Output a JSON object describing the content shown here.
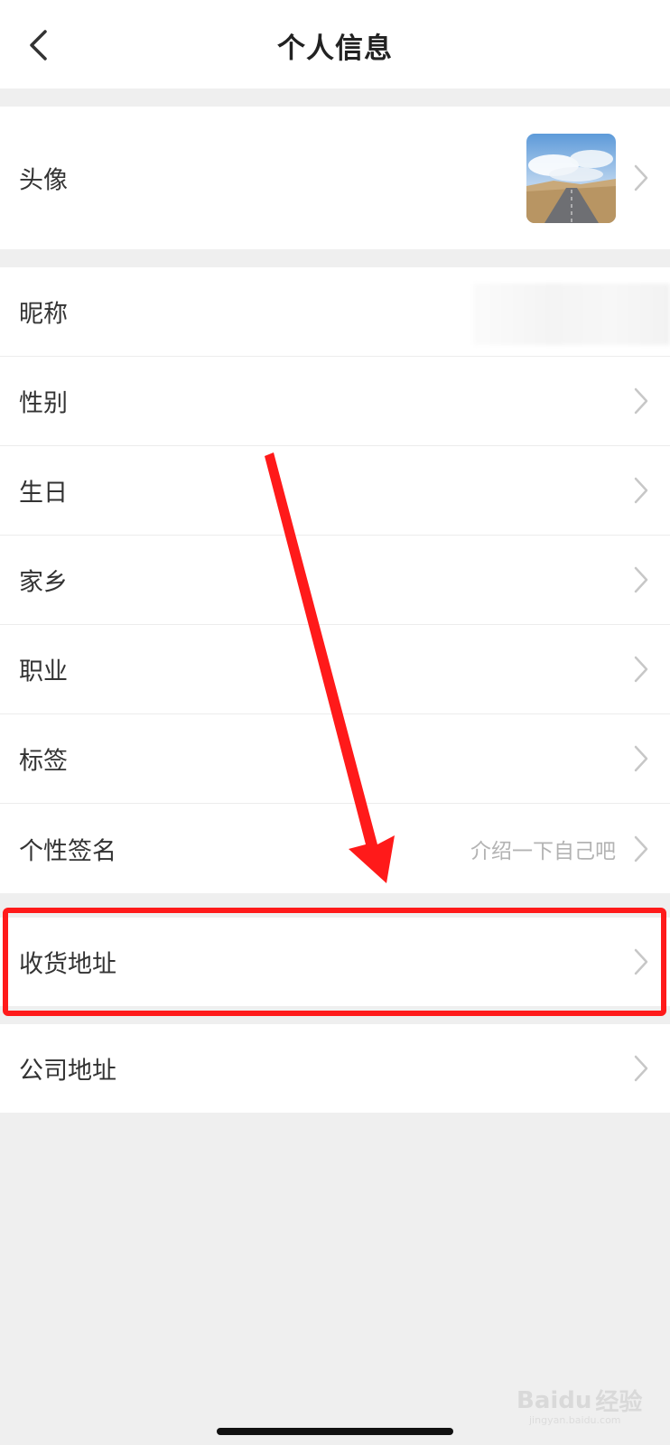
{
  "nav": {
    "title": "个人信息",
    "back_icon": "chevron-left-icon"
  },
  "avatar_row": {
    "label": "头像",
    "image": "avatar-photo-road-landscape"
  },
  "rows": [
    {
      "key": "nickname",
      "label": "昵称",
      "value": ""
    },
    {
      "key": "gender",
      "label": "性别",
      "value": ""
    },
    {
      "key": "birthday",
      "label": "生日",
      "value": ""
    },
    {
      "key": "hometown",
      "label": "家乡",
      "value": ""
    },
    {
      "key": "occupation",
      "label": "职业",
      "value": ""
    },
    {
      "key": "tags",
      "label": "标签",
      "value": ""
    },
    {
      "key": "signature",
      "label": "个性签名",
      "value": "介绍一下自己吧"
    }
  ],
  "shipping_address": {
    "label": "收货地址"
  },
  "company_address": {
    "label": "公司地址"
  },
  "annotation": {
    "arrow_color": "#ff1a1a",
    "highlight_color": "#ff1a1a"
  },
  "watermark": {
    "brand": "Baidu",
    "suffix": "经验",
    "url": "jingyan.baidu.com"
  },
  "colors": {
    "background": "#efefef",
    "row_background": "#ffffff",
    "label_text": "#333333",
    "hint_text": "#b3b3b3",
    "chevron": "#c7c7c7"
  }
}
